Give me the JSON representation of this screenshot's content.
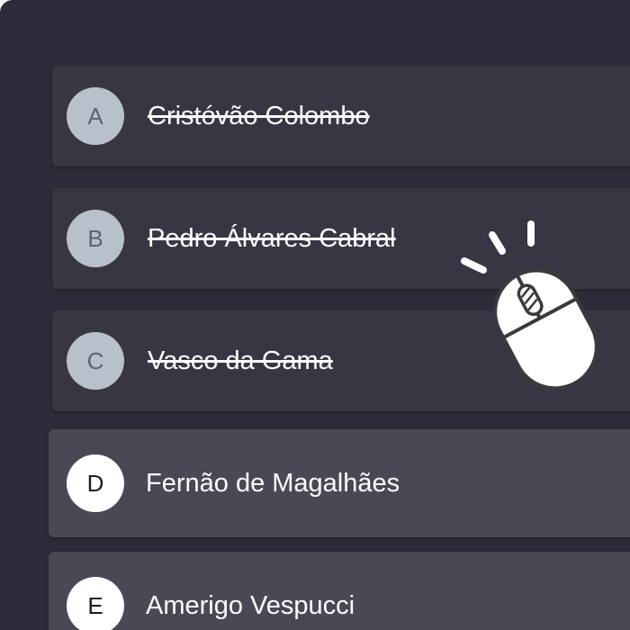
{
  "options": [
    {
      "letter": "A",
      "text": "Cristóvão Colombo",
      "eliminated": true
    },
    {
      "letter": "B",
      "text": "Pedro Álvares Cabral",
      "eliminated": true
    },
    {
      "letter": "C",
      "text": "Vasco da Gama",
      "eliminated": true
    },
    {
      "letter": "D",
      "text": "Fernão de Magalhães",
      "eliminated": false
    },
    {
      "letter": "E",
      "text": "Amerigo Vespucci",
      "eliminated": false
    }
  ],
  "icons": {
    "cursor_hint": "mouse-click-icon"
  },
  "colors": {
    "background": "#2e2b3a",
    "eliminated_row": "#393644",
    "active_row": "#4b4856",
    "eliminated_badge": "#b8c1cb",
    "active_badge": "#ffffff"
  }
}
